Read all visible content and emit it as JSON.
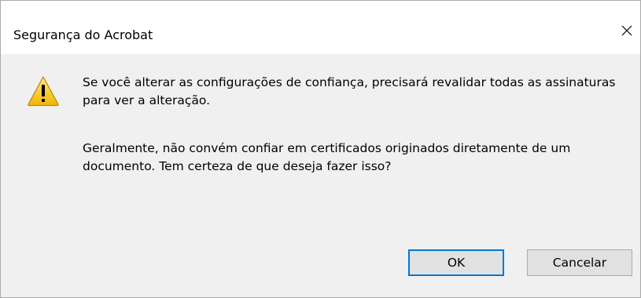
{
  "dialog": {
    "title": "Segurança do Acrobat",
    "message_1": "Se você alterar as configurações de confiança, precisará revalidar todas as assinaturas para ver a alteração.",
    "message_2": "Geralmente, não convém confiar em certificados originados diretamente de um documento. Tem certeza de que deseja fazer isso?",
    "icon": "warning-icon",
    "buttons": {
      "ok_label": "OK",
      "cancel_label": "Cancelar"
    }
  },
  "colors": {
    "titlebar_bg": "#ffffff",
    "body_bg": "#f0f0f0",
    "button_bg": "#e1e1e1",
    "default_button_border": "#0078d7",
    "warning_yellow": "#f7c600"
  }
}
